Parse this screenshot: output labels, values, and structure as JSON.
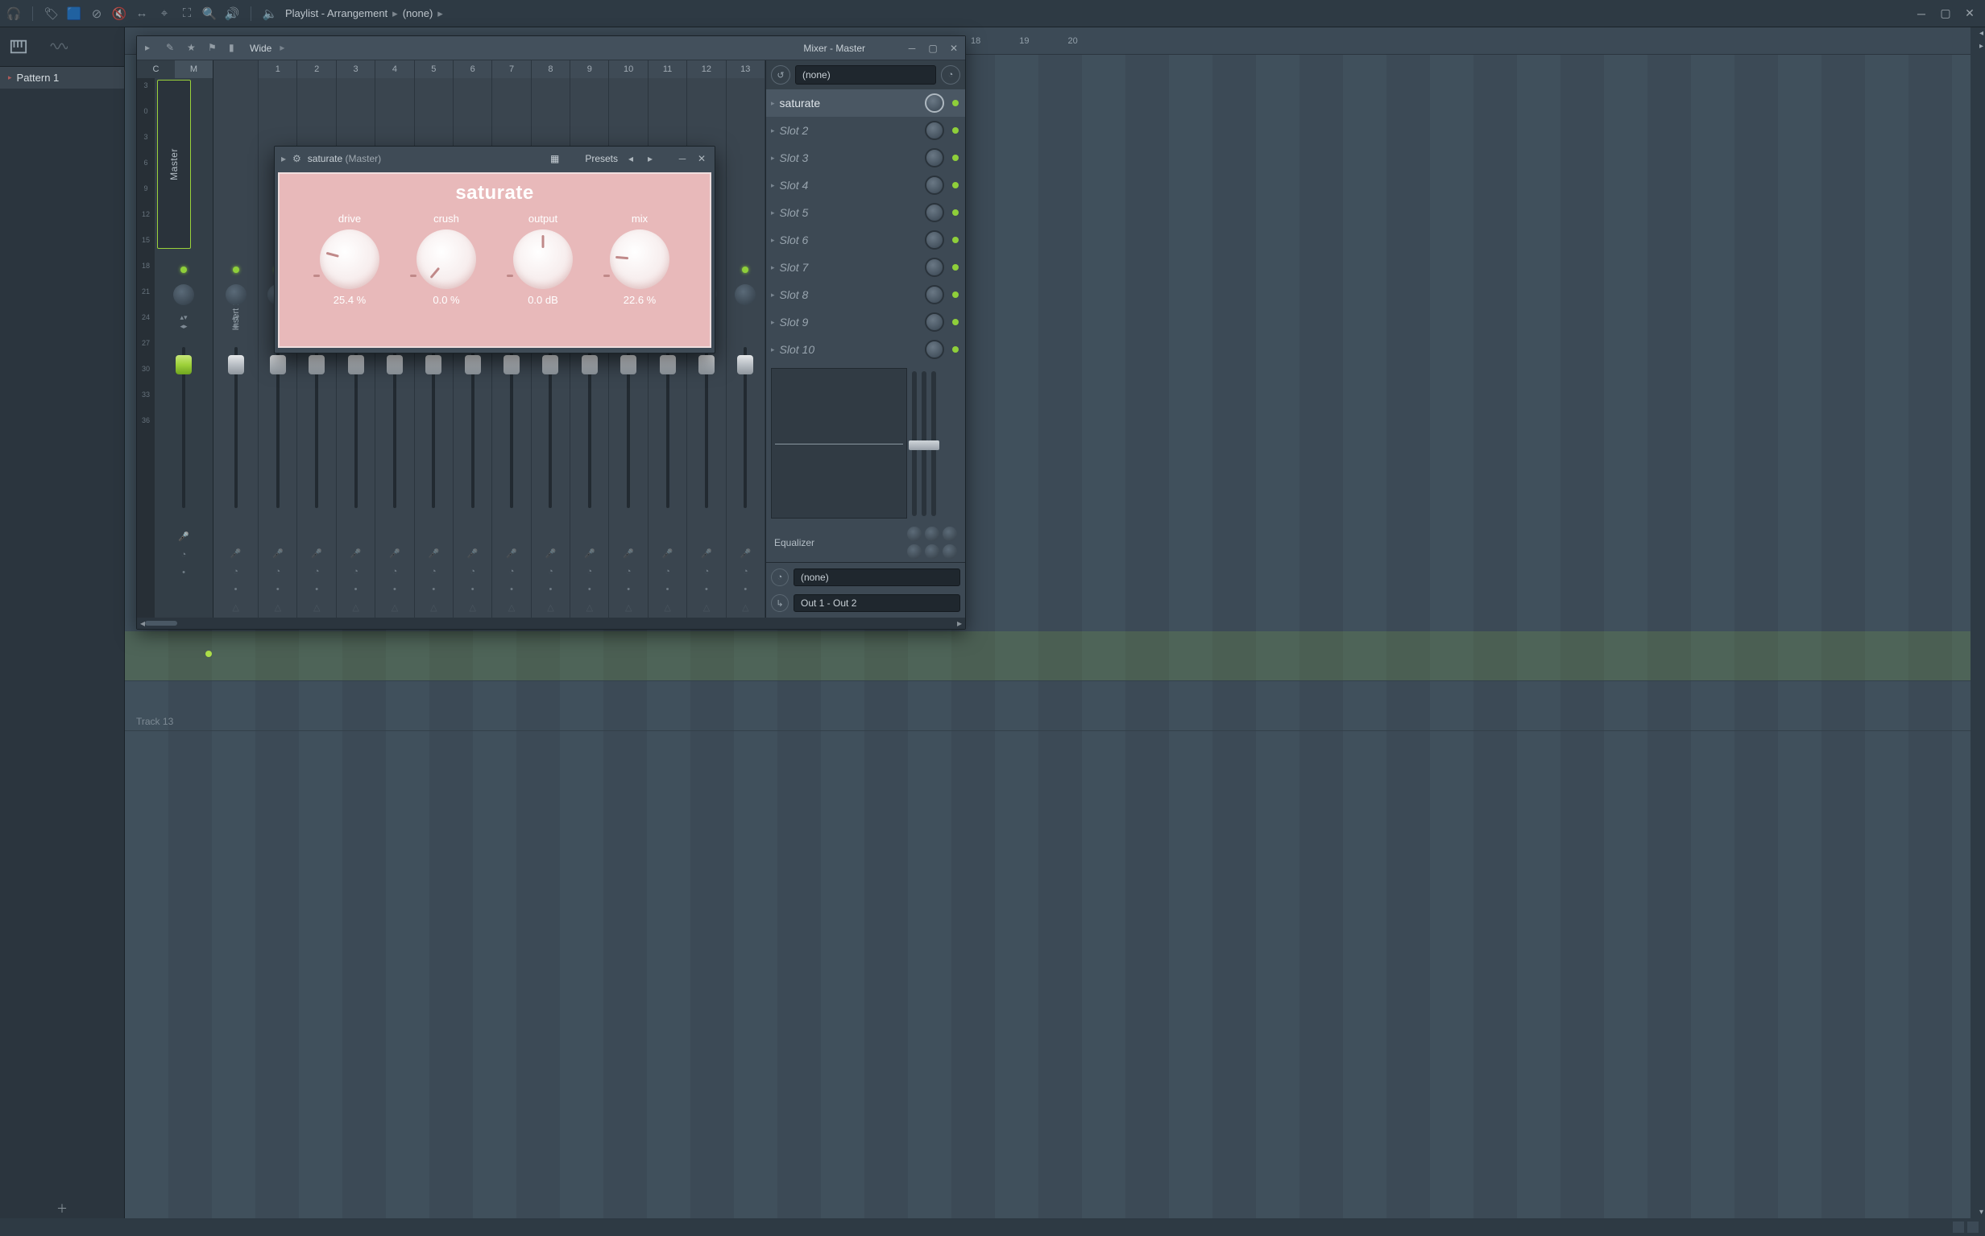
{
  "app": {
    "breadcrumb": [
      "Playlist - Arrangement",
      "(none)"
    ]
  },
  "sidebar": {
    "pattern": "Pattern 1"
  },
  "playlist": {
    "rulerStart": 18,
    "rulerMarks": [
      "18",
      "19",
      "20"
    ],
    "trackRow": "Track 13"
  },
  "mixer": {
    "title": "Mixer - Master",
    "toolbarWidth": "Wide",
    "cm": [
      "C",
      "M"
    ],
    "dbTicks": [
      "3",
      "0",
      "3",
      "6",
      "9",
      "12",
      "15",
      "18",
      "21",
      "24",
      "27",
      "30",
      "33",
      "36"
    ],
    "masterLabel": "Master",
    "insert1": "Insert 1",
    "trackNumbers": [
      "1",
      "2",
      "3",
      "4",
      "5",
      "6",
      "7",
      "8",
      "9",
      "10",
      "11",
      "12",
      "13"
    ],
    "fx": {
      "preset": "(none)",
      "slots": [
        {
          "name": "saturate",
          "loaded": true
        },
        {
          "name": "Slot 2",
          "loaded": false
        },
        {
          "name": "Slot 3",
          "loaded": false
        },
        {
          "name": "Slot 4",
          "loaded": false
        },
        {
          "name": "Slot 5",
          "loaded": false
        },
        {
          "name": "Slot 6",
          "loaded": false
        },
        {
          "name": "Slot 7",
          "loaded": false
        },
        {
          "name": "Slot 8",
          "loaded": false
        },
        {
          "name": "Slot 9",
          "loaded": false
        },
        {
          "name": "Slot 10",
          "loaded": false
        }
      ],
      "eqLabel": "Equalizer",
      "inNone": "(none)",
      "out": "Out 1 - Out 2"
    }
  },
  "plugin": {
    "name_plain": "saturate",
    "master": "(Master)",
    "presetLabel": "Presets",
    "title": "saturate",
    "knobs": [
      {
        "label": "drive",
        "value": "25.4 %",
        "rotClass": "d1"
      },
      {
        "label": "crush",
        "value": "0.0 %",
        "rotClass": "d2"
      },
      {
        "label": "output",
        "value": "0.0 dB",
        "rotClass": "d3"
      },
      {
        "label": "mix",
        "value": "22.6 %",
        "rotClass": "d4"
      }
    ]
  }
}
